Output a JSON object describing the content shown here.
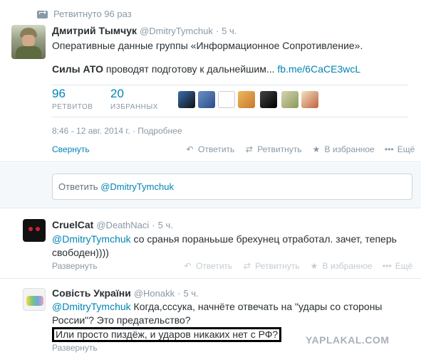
{
  "main_tweet": {
    "retweeted_label": "Ретвитнуто 96 раз",
    "author_name": "Дмитрий Тымчук",
    "author_handle": "@DmitryTymchuk",
    "time": "5 ч.",
    "text_line1": "Оперативные данные группы «Информационное Сопротивление».",
    "text_bold": "Силы АТО",
    "text_line2": " проводят подготову к дальнейшим... ",
    "link": "fb.me/6CaCE3wcL",
    "retweets_count": "96",
    "retweets_label": "РЕТВИТОВ",
    "favorites_count": "20",
    "favorites_label": "ИЗБРАННЫХ",
    "datetime": "8:46 - 12 авг. 2014 г. · Подробнее",
    "collapse_label": "Свернуть",
    "actions": {
      "reply": "Ответить",
      "retweet": "Ретвитнуть",
      "favorite": "В избранное",
      "more": "Ещё"
    }
  },
  "reply_box": {
    "placeholder": "Ответить ",
    "mention": "@DmitryTymchuk"
  },
  "replies": [
    {
      "author_name": "CruelCat",
      "author_handle": "@DeathNaci",
      "time": "5 ч.",
      "mention": "@DmitryTymchuk",
      "text": " со сранья поранььше брехунец отработал. зачет, теперь свободен))))",
      "expand_label": "Развернуть"
    },
    {
      "author_name": "Совість України",
      "author_handle": "@Honakk",
      "time": "5 ч.",
      "mention": "@DmitryTymchuk",
      "text": " Когда,сссука, начнёте отвечать на \"удары со стороны России\"? Это предательство?",
      "highlighted_text": "Или просто пиздёж, и ударов никаких нет с РФ?",
      "expand_label": "Развернуть"
    }
  ],
  "actions_dim": {
    "reply": "Ответить",
    "retweet": "Ретвитнуть",
    "favorite": "В избранное",
    "more": "Ещё"
  },
  "watermark": "YAPLAKAL.COM",
  "colors": {
    "link": "#0084b4",
    "muted": "#8899a6",
    "retweet_green": "#19cf86",
    "border": "#e1e8ed"
  },
  "icons": [
    "retweet-icon",
    "reply-icon",
    "favorite-star-icon",
    "more-dots-icon"
  ]
}
